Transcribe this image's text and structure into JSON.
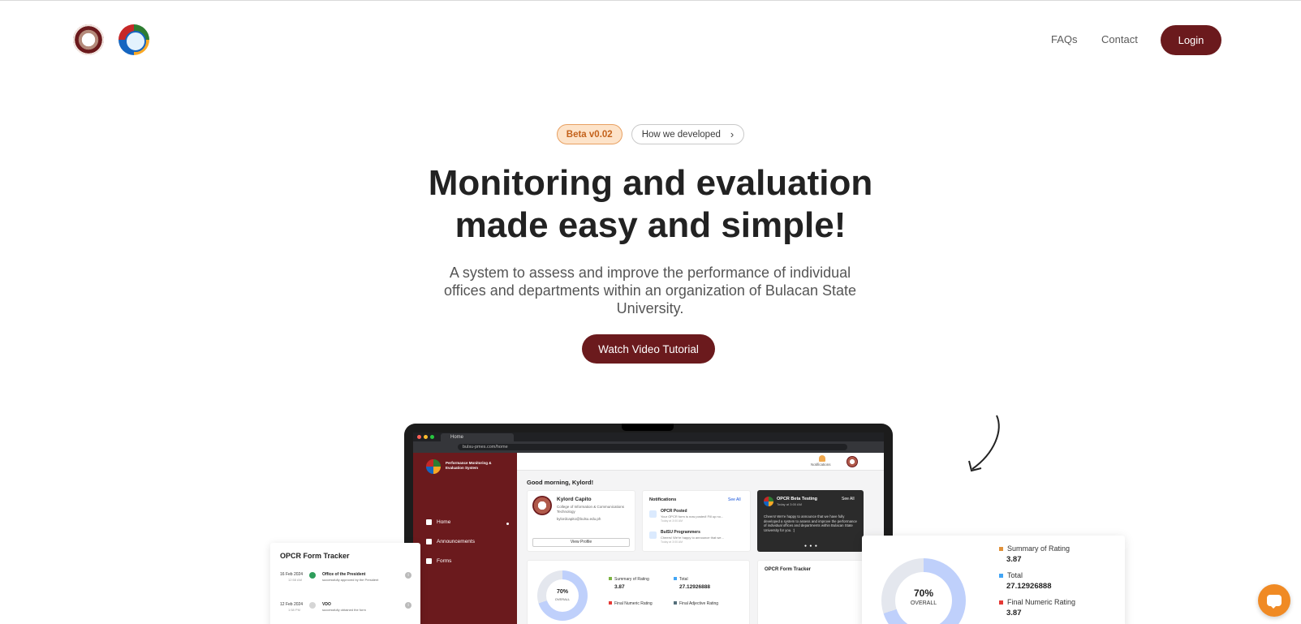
{
  "header": {
    "nav": {
      "faqs": "FAQs",
      "contact": "Contact",
      "login": "Login"
    }
  },
  "hero": {
    "beta_badge": "Beta v0.02",
    "how_link": "How we developed",
    "title_line1": "Monitoring and evaluation",
    "title_line2": "made easy and simple!",
    "subtitle": "A system to assess and improve the performance of individual offices and departments within an organization of Bulacan State University.",
    "cta": "Watch Video Tutorial"
  },
  "preview": {
    "browser": {
      "tab_title": "Home",
      "url": "bulsu-pmes.com/home"
    },
    "app_title": "Performance Monitoring & Evaluation System",
    "sidebar": [
      "Home",
      "Announcements",
      "Forms"
    ],
    "notifications_label": "Notifications",
    "greeting": "Good morning, Kylord!",
    "profile": {
      "name": "Kylord Capito",
      "college": "College of Information & Communications Technology",
      "email": "kylordcapito@bulsu.edu.ph",
      "button": "View Profile"
    },
    "notifications": {
      "title": "Notifications",
      "see_all": "See All",
      "items": [
        {
          "title": "OPCR Posted",
          "desc": "Your OPCR form is now posted! Fill up no...",
          "time": "Today at 3:00 AM"
        },
        {
          "title": "BulSU Programmers",
          "desc": "Cheers! We're happy to announce that we...",
          "time": "Today at 3:00 AM"
        }
      ]
    },
    "beta_card": {
      "title": "OPCR Beta Testing",
      "time": "Today at 3:00 AM",
      "see_all": "See All",
      "body": "Cheers! We're happy to announce that we have fully developed a system to assess and improve the performance of individual offices and departments within Bulacan State University for you. :)",
      "dots": "● ● ●"
    },
    "rating": {
      "percent": "70%",
      "overall": "OVERALL",
      "summary_label": "Summary of Rating",
      "summary_value": "3.87",
      "total_label": "Total",
      "total_value": "27.12926888",
      "fnr_label": "Final Numeric Rating",
      "far_label": "Final Adjective Rating"
    },
    "tracker_title": "OPCR Form Tracker"
  },
  "float_left": {
    "title": "OPCR Form Tracker",
    "rows": [
      {
        "date": "16 Feb 2024",
        "time": "12:58 AM",
        "office": "Office of the President",
        "desc": "successfully approved by the President"
      },
      {
        "date": "12 Feb 2024",
        "time": "1:58 PM",
        "office": "VDO",
        "desc": "successfully obtained the form"
      }
    ]
  },
  "float_right": {
    "percent": "70%",
    "overall": "OVERALL",
    "summary_label": "Summary of Rating",
    "summary_value": "3.87",
    "total_label": "Total",
    "total_value": "27.12926888",
    "fnr_label": "Final Numeric Rating",
    "fnr_value": "3.87"
  },
  "colors": {
    "brand": "#6b1a1d",
    "beta_bg": "#fde3c9",
    "beta_text": "#c4621b",
    "accent_orange": "#f08a24"
  },
  "icons": [
    "bsu-seal-logo",
    "college-gear-logo",
    "chevron-right-icon",
    "curved-arrow-icon",
    "chat-icon"
  ]
}
